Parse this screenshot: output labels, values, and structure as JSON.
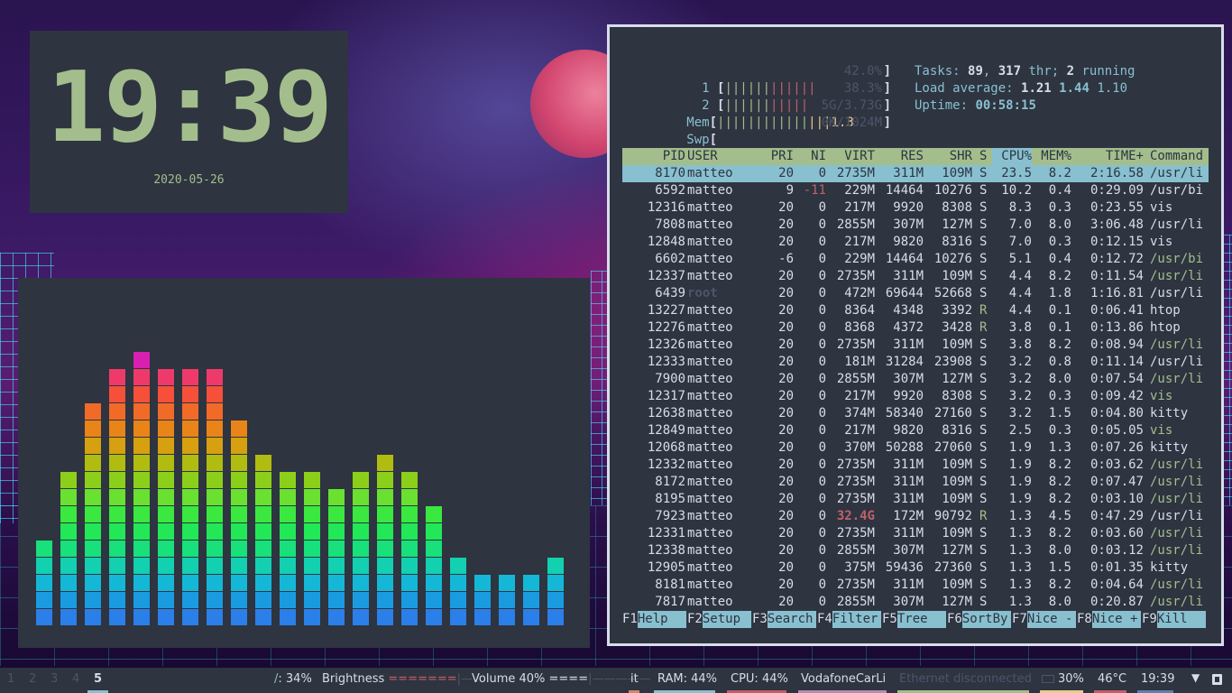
{
  "clock": {
    "time": "19:39",
    "date": "2020-05-26"
  },
  "visualizer": {
    "levels": [
      5,
      9,
      13,
      15,
      16,
      15,
      15,
      15,
      12,
      10,
      9,
      9,
      8,
      9,
      10,
      9,
      7,
      4,
      3,
      3,
      3,
      4
    ],
    "colors": [
      "#2a7fe8",
      "#1a9be0",
      "#14b8d6",
      "#12d0b0",
      "#18e07a",
      "#22e858",
      "#3ae840",
      "#6ae030",
      "#8ccf1a",
      "#b0bc10",
      "#d6a010",
      "#e88418",
      "#f26a28",
      "#f6503a",
      "#ee3a6a",
      "#d820b0"
    ]
  },
  "htop": {
    "meters": [
      {
        "label": "1",
        "bars_g": "||||||",
        "bars_r": "||||||",
        "bars_y": "",
        "value": "42.0%"
      },
      {
        "label": "2",
        "bars_g": "||||||",
        "bars_r": "|||||",
        "bars_y": "",
        "value": "38.3%"
      },
      {
        "label": "Mem",
        "bars_g": "||||||||||||",
        "bars_r": "",
        "bars_y": "|||1.3",
        "value": "5G/3.73G"
      },
      {
        "label": "Swp",
        "bars_g": "",
        "bars_r": "",
        "bars_y": "",
        "value": "0K/1024M"
      }
    ],
    "tasks": {
      "label": "Tasks: ",
      "count": "89",
      "sep1": ", ",
      "thr": "317",
      "thr_label": " thr; ",
      "running": "2",
      "running_label": " running"
    },
    "load": {
      "label": "Load average: ",
      "l1": "1.21",
      "l5": "1.44",
      "l15": "1.10"
    },
    "uptime": {
      "label": "Uptime: ",
      "value": "00:58:15"
    },
    "columns": [
      "PID",
      "USER",
      "PRI",
      "NI",
      "VIRT",
      "RES",
      "SHR",
      "S",
      "CPU%",
      "MEM%",
      "TIME+",
      "Command"
    ],
    "processes": [
      {
        "pid": "8170",
        "user": "matteo",
        "pri": "20",
        "ni": "0",
        "virt": "2735M",
        "res": "311M",
        "shr": "109M",
        "s": "S",
        "cpu": "23.5",
        "mem": "8.2",
        "time": "2:16.58",
        "cmd": "/usr/li",
        "selected": true
      },
      {
        "pid": "6592",
        "user": "matteo",
        "pri": "9",
        "ni": "-11",
        "virt": "229M",
        "res": "14464",
        "shr": "10276",
        "s": "S",
        "cpu": "10.2",
        "mem": "0.4",
        "time": "0:29.09",
        "cmd": "/usr/bi"
      },
      {
        "pid": "12316",
        "user": "matteo",
        "pri": "20",
        "ni": "0",
        "virt": "217M",
        "res": "9920",
        "shr": "8308",
        "s": "S",
        "cpu": "8.3",
        "mem": "0.3",
        "time": "0:23.55",
        "cmd": "vis"
      },
      {
        "pid": "7808",
        "user": "matteo",
        "pri": "20",
        "ni": "0",
        "virt": "2855M",
        "res": "307M",
        "shr": "127M",
        "s": "S",
        "cpu": "7.0",
        "mem": "8.0",
        "time": "3:06.48",
        "cmd": "/usr/li"
      },
      {
        "pid": "12848",
        "user": "matteo",
        "pri": "20",
        "ni": "0",
        "virt": "217M",
        "res": "9820",
        "shr": "8316",
        "s": "S",
        "cpu": "7.0",
        "mem": "0.3",
        "time": "0:12.15",
        "cmd": "vis"
      },
      {
        "pid": "6602",
        "user": "matteo",
        "pri": "-6",
        "ni": "0",
        "virt": "229M",
        "res": "14464",
        "shr": "10276",
        "s": "S",
        "cpu": "5.1",
        "mem": "0.4",
        "time": "0:12.72",
        "cmd": "/usr/bi",
        "thread": true
      },
      {
        "pid": "12337",
        "user": "matteo",
        "pri": "20",
        "ni": "0",
        "virt": "2735M",
        "res": "311M",
        "shr": "109M",
        "s": "S",
        "cpu": "4.4",
        "mem": "8.2",
        "time": "0:11.54",
        "cmd": "/usr/li",
        "thread": true
      },
      {
        "pid": "6439",
        "user": "root",
        "pri": "20",
        "ni": "0",
        "virt": "472M",
        "res": "69644",
        "shr": "52668",
        "s": "S",
        "cpu": "4.4",
        "mem": "1.8",
        "time": "1:16.81",
        "cmd": "/usr/li"
      },
      {
        "pid": "13227",
        "user": "matteo",
        "pri": "20",
        "ni": "0",
        "virt": "8364",
        "res": "4348",
        "shr": "3392",
        "s": "R",
        "cpu": "4.4",
        "mem": "0.1",
        "time": "0:06.41",
        "cmd": "htop"
      },
      {
        "pid": "12276",
        "user": "matteo",
        "pri": "20",
        "ni": "0",
        "virt": "8368",
        "res": "4372",
        "shr": "3428",
        "s": "R",
        "cpu": "3.8",
        "mem": "0.1",
        "time": "0:13.86",
        "cmd": "htop"
      },
      {
        "pid": "12326",
        "user": "matteo",
        "pri": "20",
        "ni": "0",
        "virt": "2735M",
        "res": "311M",
        "shr": "109M",
        "s": "S",
        "cpu": "3.8",
        "mem": "8.2",
        "time": "0:08.94",
        "cmd": "/usr/li",
        "thread": true
      },
      {
        "pid": "12333",
        "user": "matteo",
        "pri": "20",
        "ni": "0",
        "virt": "181M",
        "res": "31284",
        "shr": "23908",
        "s": "S",
        "cpu": "3.2",
        "mem": "0.8",
        "time": "0:11.14",
        "cmd": "/usr/li"
      },
      {
        "pid": "7900",
        "user": "matteo",
        "pri": "20",
        "ni": "0",
        "virt": "2855M",
        "res": "307M",
        "shr": "127M",
        "s": "S",
        "cpu": "3.2",
        "mem": "8.0",
        "time": "0:07.54",
        "cmd": "/usr/li",
        "thread": true
      },
      {
        "pid": "12317",
        "user": "matteo",
        "pri": "20",
        "ni": "0",
        "virt": "217M",
        "res": "9920",
        "shr": "8308",
        "s": "S",
        "cpu": "3.2",
        "mem": "0.3",
        "time": "0:09.42",
        "cmd": "vis",
        "thread": true
      },
      {
        "pid": "12638",
        "user": "matteo",
        "pri": "20",
        "ni": "0",
        "virt": "374M",
        "res": "58340",
        "shr": "27160",
        "s": "S",
        "cpu": "3.2",
        "mem": "1.5",
        "time": "0:04.80",
        "cmd": "kitty"
      },
      {
        "pid": "12849",
        "user": "matteo",
        "pri": "20",
        "ni": "0",
        "virt": "217M",
        "res": "9820",
        "shr": "8316",
        "s": "S",
        "cpu": "2.5",
        "mem": "0.3",
        "time": "0:05.05",
        "cmd": "vis",
        "thread": true
      },
      {
        "pid": "12068",
        "user": "matteo",
        "pri": "20",
        "ni": "0",
        "virt": "370M",
        "res": "50288",
        "shr": "27060",
        "s": "S",
        "cpu": "1.9",
        "mem": "1.3",
        "time": "0:07.26",
        "cmd": "kitty"
      },
      {
        "pid": "12332",
        "user": "matteo",
        "pri": "20",
        "ni": "0",
        "virt": "2735M",
        "res": "311M",
        "shr": "109M",
        "s": "S",
        "cpu": "1.9",
        "mem": "8.2",
        "time": "0:03.62",
        "cmd": "/usr/li",
        "thread": true
      },
      {
        "pid": "8172",
        "user": "matteo",
        "pri": "20",
        "ni": "0",
        "virt": "2735M",
        "res": "311M",
        "shr": "109M",
        "s": "S",
        "cpu": "1.9",
        "mem": "8.2",
        "time": "0:07.47",
        "cmd": "/usr/li",
        "thread": true
      },
      {
        "pid": "8195",
        "user": "matteo",
        "pri": "20",
        "ni": "0",
        "virt": "2735M",
        "res": "311M",
        "shr": "109M",
        "s": "S",
        "cpu": "1.9",
        "mem": "8.2",
        "time": "0:03.10",
        "cmd": "/usr/li",
        "thread": true
      },
      {
        "pid": "7923",
        "user": "matteo",
        "pri": "20",
        "ni": "0",
        "virt": "32.4G",
        "res": "172M",
        "shr": "90792",
        "s": "R",
        "cpu": "1.3",
        "mem": "4.5",
        "time": "0:47.29",
        "cmd": "/usr/li",
        "bigvirt": true
      },
      {
        "pid": "12331",
        "user": "matteo",
        "pri": "20",
        "ni": "0",
        "virt": "2735M",
        "res": "311M",
        "shr": "109M",
        "s": "S",
        "cpu": "1.3",
        "mem": "8.2",
        "time": "0:03.60",
        "cmd": "/usr/li",
        "thread": true
      },
      {
        "pid": "12338",
        "user": "matteo",
        "pri": "20",
        "ni": "0",
        "virt": "2855M",
        "res": "307M",
        "shr": "127M",
        "s": "S",
        "cpu": "1.3",
        "mem": "8.0",
        "time": "0:03.12",
        "cmd": "/usr/li",
        "thread": true
      },
      {
        "pid": "12905",
        "user": "matteo",
        "pri": "20",
        "ni": "0",
        "virt": "375M",
        "res": "59436",
        "shr": "27360",
        "s": "S",
        "cpu": "1.3",
        "mem": "1.5",
        "time": "0:01.35",
        "cmd": "kitty"
      },
      {
        "pid": "8181",
        "user": "matteo",
        "pri": "20",
        "ni": "0",
        "virt": "2735M",
        "res": "311M",
        "shr": "109M",
        "s": "S",
        "cpu": "1.3",
        "mem": "8.2",
        "time": "0:04.64",
        "cmd": "/usr/li",
        "thread": true
      },
      {
        "pid": "7817",
        "user": "matteo",
        "pri": "20",
        "ni": "0",
        "virt": "2855M",
        "res": "307M",
        "shr": "127M",
        "s": "S",
        "cpu": "1.3",
        "mem": "8.0",
        "time": "0:20.87",
        "cmd": "/usr/li",
        "thread": true
      }
    ],
    "fkeys": [
      {
        "key": "F1",
        "label": "Help"
      },
      {
        "key": "F2",
        "label": "Setup"
      },
      {
        "key": "F3",
        "label": "Search"
      },
      {
        "key": "F4",
        "label": "Filter"
      },
      {
        "key": "F5",
        "label": "Tree"
      },
      {
        "key": "F6",
        "label": "SortBy"
      },
      {
        "key": "F7",
        "label": "Nice -"
      },
      {
        "key": "F8",
        "label": "Nice +"
      },
      {
        "key": "F9",
        "label": "Kill"
      }
    ]
  },
  "statusbar": {
    "workspaces": [
      "1",
      "2",
      "3",
      "4",
      "5"
    ],
    "active_workspace": "5",
    "disk": {
      "icon": "/",
      "value": ": 34%"
    },
    "brightness": {
      "label": "Brightness ",
      "bar": "=======",
      "rest": "|—"
    },
    "volume": {
      "label": "Volume 40% ",
      "bar": "====",
      "rest": "|—————"
    },
    "keyboard": "it",
    "ram": "RAM: 44%",
    "cpu": "CPU: 44%",
    "wifi": "VodafoneCarLi",
    "ethernet": "Ethernet disconnected",
    "battery": "30%",
    "temp": "46°C",
    "time": "19:39",
    "colors": {
      "ram": "#88c0d0",
      "cpu": "#bf616a",
      "wifi": "#b48ead",
      "ethernet": "#a3be8c",
      "battery": "#ebcb8b",
      "temp": "#bf616a",
      "time": "#5e81ac",
      "kbd": "#d08770"
    }
  }
}
